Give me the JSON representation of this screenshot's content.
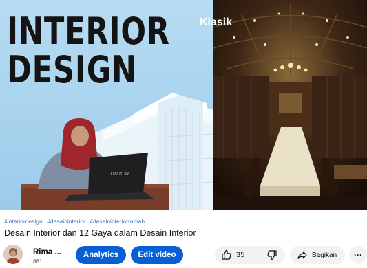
{
  "thumbnail": {
    "title_line1": "INTERIOR",
    "title_line2": "DESIGN",
    "right_label": "Klasik",
    "laptop_brand": "TOSHIBA"
  },
  "video": {
    "hashtags": [
      "#interiordesign",
      "#desaininterior",
      "#desaininteriorrumah"
    ],
    "title": "Desain Interior dan 12 Gaya dalam Desain Interior"
  },
  "channel": {
    "name": "Rima ...",
    "subscribers": "881..."
  },
  "actions": {
    "analytics_label": "Analytics",
    "edit_label": "Edit video",
    "like_count": "35",
    "share_label": "Bagikan",
    "more_label": "···"
  },
  "colors": {
    "accent": "#065fd4",
    "hashtag": "#3e6fbf",
    "chip_bg": "#f2f2f2"
  },
  "icons": [
    "thumbs-up-icon",
    "thumbs-down-icon",
    "share-icon",
    "more-icon"
  ]
}
